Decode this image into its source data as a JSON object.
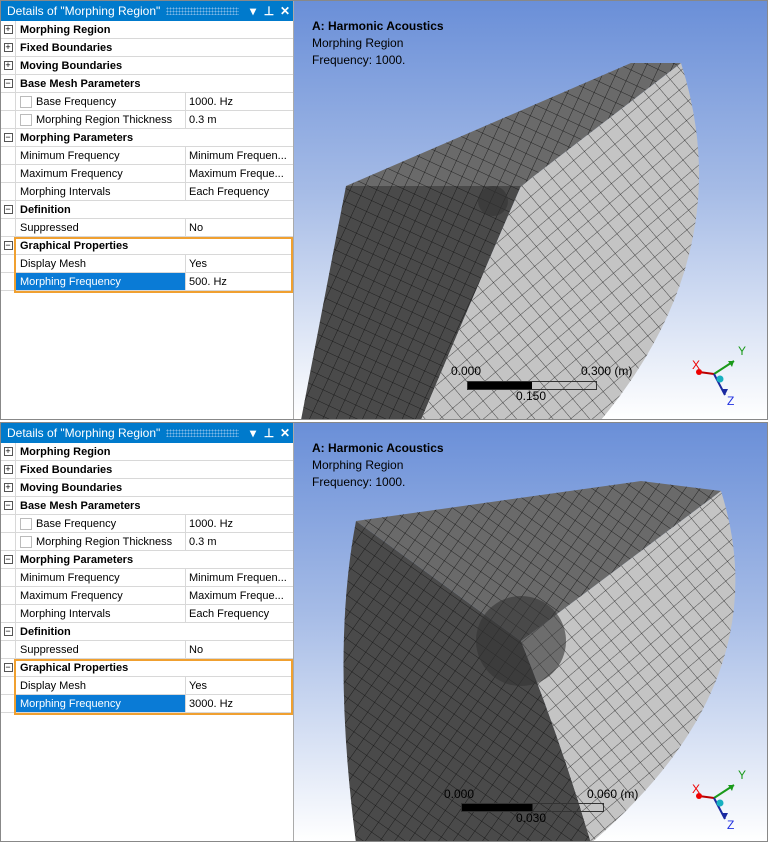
{
  "panels": [
    {
      "header": {
        "title": "Details of \"Morphing Region\""
      },
      "rows": [
        {
          "type": "group",
          "expander": "+",
          "label": "Morphing Region"
        },
        {
          "type": "group",
          "expander": "+",
          "label": "Fixed Boundaries"
        },
        {
          "type": "group",
          "expander": "+",
          "label": "Moving Boundaries"
        },
        {
          "type": "group",
          "expander": "−",
          "label": "Base Mesh Parameters"
        },
        {
          "type": "prop",
          "checkbox": true,
          "name": "Base Frequency",
          "value": "1000. Hz"
        },
        {
          "type": "prop",
          "checkbox": true,
          "name": "Morphing Region Thickness",
          "value": "0.3 m"
        },
        {
          "type": "group",
          "expander": "−",
          "label": "Morphing Parameters"
        },
        {
          "type": "prop",
          "name": "Minimum Frequency",
          "value": "Minimum Frequen..."
        },
        {
          "type": "prop",
          "name": "Maximum Frequency",
          "value": "Maximum Freque..."
        },
        {
          "type": "prop",
          "name": "Morphing Intervals",
          "value": "Each Frequency"
        },
        {
          "type": "group",
          "expander": "−",
          "label": "Definition"
        },
        {
          "type": "prop",
          "name": "Suppressed",
          "value": "No"
        },
        {
          "type": "group",
          "expander": "−",
          "label": "Graphical Properties"
        },
        {
          "type": "prop",
          "name": "Display Mesh",
          "value": "Yes"
        },
        {
          "type": "prop",
          "name": "Morphing Frequency",
          "value": "500. Hz",
          "selected": true
        }
      ],
      "viewport": {
        "title": "A: Harmonic Acoustics",
        "subtitle": "Morphing Region",
        "frequency": "Frequency: 1000.",
        "scale": {
          "min": "0.000",
          "mid": "0.150",
          "max": "0.300 (m)"
        },
        "axes": {
          "x": "X",
          "y": "Y",
          "z": "Z"
        }
      }
    },
    {
      "header": {
        "title": "Details of \"Morphing Region\""
      },
      "rows": [
        {
          "type": "group",
          "expander": "+",
          "label": "Morphing Region"
        },
        {
          "type": "group",
          "expander": "+",
          "label": "Fixed Boundaries"
        },
        {
          "type": "group",
          "expander": "+",
          "label": "Moving Boundaries"
        },
        {
          "type": "group",
          "expander": "−",
          "label": "Base Mesh Parameters"
        },
        {
          "type": "prop",
          "checkbox": true,
          "name": "Base Frequency",
          "value": "1000. Hz"
        },
        {
          "type": "prop",
          "checkbox": true,
          "name": "Morphing Region Thickness",
          "value": "0.3 m"
        },
        {
          "type": "group",
          "expander": "−",
          "label": "Morphing Parameters"
        },
        {
          "type": "prop",
          "name": "Minimum Frequency",
          "value": "Minimum Frequen..."
        },
        {
          "type": "prop",
          "name": "Maximum Frequency",
          "value": "Maximum Freque..."
        },
        {
          "type": "prop",
          "name": "Morphing Intervals",
          "value": "Each Frequency"
        },
        {
          "type": "group",
          "expander": "−",
          "label": "Definition"
        },
        {
          "type": "prop",
          "name": "Suppressed",
          "value": "No"
        },
        {
          "type": "group",
          "expander": "−",
          "label": "Graphical Properties"
        },
        {
          "type": "prop",
          "name": "Display Mesh",
          "value": "Yes"
        },
        {
          "type": "prop",
          "name": "Morphing Frequency",
          "value": "3000. Hz",
          "selected": true
        }
      ],
      "viewport": {
        "title": "A: Harmonic Acoustics",
        "subtitle": "Morphing Region",
        "frequency": "Frequency: 1000.",
        "scale": {
          "min": "0.000",
          "mid": "0.030",
          "max": "0.060 (m)"
        },
        "axes": {
          "x": "X",
          "y": "Y",
          "z": "Z"
        }
      }
    }
  ]
}
